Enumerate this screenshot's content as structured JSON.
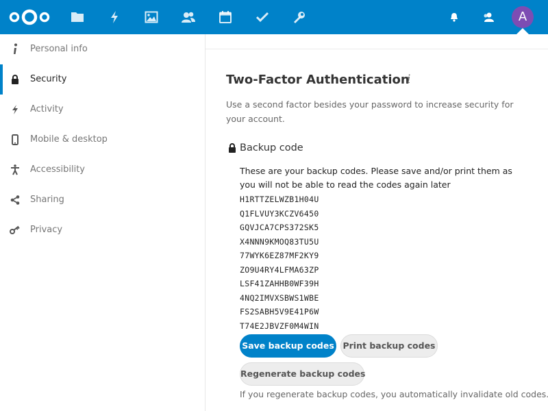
{
  "header": {
    "logo_icon": "nextcloud-logo",
    "apps": [
      {
        "name": "files",
        "icon": "folder-icon"
      },
      {
        "name": "activity",
        "icon": "lightning-icon"
      },
      {
        "name": "photos",
        "icon": "image-icon"
      },
      {
        "name": "contacts",
        "icon": "contacts-icon"
      },
      {
        "name": "calendar",
        "icon": "calendar-icon"
      },
      {
        "name": "tasks",
        "icon": "checkmark-icon"
      },
      {
        "name": "settings",
        "icon": "wrench-icon"
      }
    ],
    "notifications_icon": "bell-icon",
    "contacts_menu_icon": "contacts-menu-icon",
    "avatar_initial": "A",
    "avatar_color": "#7d4db3",
    "accent_color": "#0082c9"
  },
  "sidebar": {
    "items": [
      {
        "label": "Personal info",
        "icon": "info-icon"
      },
      {
        "label": "Security",
        "icon": "lock-icon",
        "active": true
      },
      {
        "label": "Activity",
        "icon": "lightning-icon"
      },
      {
        "label": "Mobile & desktop",
        "icon": "phone-icon"
      },
      {
        "label": "Accessibility",
        "icon": "accessibility-icon"
      },
      {
        "label": "Sharing",
        "icon": "share-icon"
      },
      {
        "label": "Privacy",
        "icon": "key-icon"
      }
    ]
  },
  "main": {
    "title": "Two-Factor Authentication",
    "info_glyph": "i",
    "description": "Use a second factor besides your password to increase security for your account.",
    "backup": {
      "heading": "Backup code",
      "description": "These are your backup codes. Please save and/or print them as you will not be able to read the codes again later",
      "codes": [
        "H1RTTZELWZB1H04U",
        "Q1FLVUY3KCZV6450",
        "GQVJCA7CPS372SK5",
        "X4NNN9KMOQ83TU5U",
        "77WYK6EZ87MF2KY9",
        "ZO9U4RY4LFMA63ZP",
        "LSF41ZAHHB0WF39H",
        "4NQ2IMVXSBWS1WBE",
        "FS2SABH5V9E41P6W",
        "T74E2JBVZF0M4WIN"
      ],
      "save_label": "Save backup codes",
      "print_label": "Print backup codes",
      "regenerate_label": "Regenerate backup codes",
      "hint": "If you regenerate backup codes, you automatically invalidate old codes."
    }
  }
}
